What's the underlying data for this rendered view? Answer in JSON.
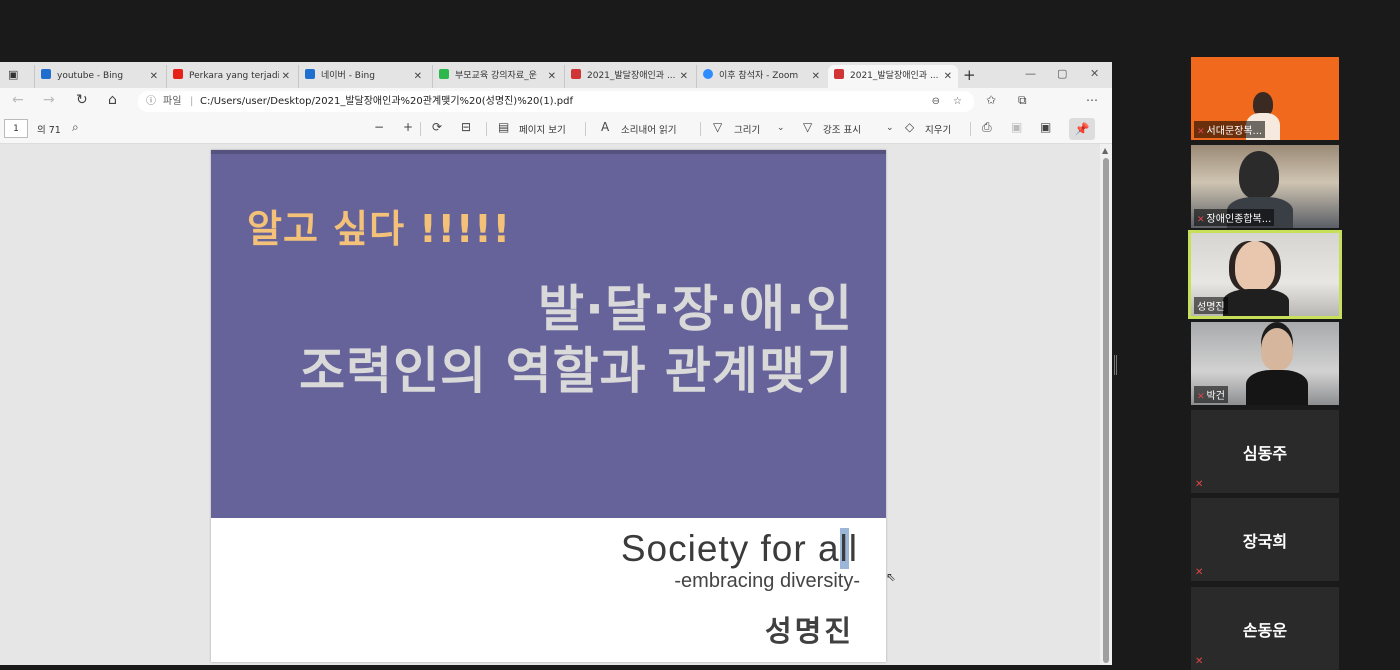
{
  "browser": {
    "tabs": [
      {
        "title": "youtube - Bing",
        "favicon": "bing-icon",
        "color": "#1f6fd1"
      },
      {
        "title": "Perkara yang terjadi a",
        "favicon": "youtube-icon",
        "color": "#e62117"
      },
      {
        "title": "네이버 - Bing",
        "favicon": "bing-icon",
        "color": "#1f6fd1"
      },
      {
        "title": "부모교육 강의자료_운",
        "favicon": "green-app-icon",
        "color": "#2db84d"
      },
      {
        "title": "2021_발달장애인과 ...",
        "favicon": "pdf-icon",
        "color": "#d03434"
      },
      {
        "title": "이후 참석자 - Zoom",
        "favicon": "zoom-icon",
        "color": "#2d8cff"
      },
      {
        "title": "2021_발달장애인과 ...",
        "favicon": "pdf-icon",
        "color": "#d03434"
      }
    ],
    "address": {
      "file_label": "파일",
      "url": "C:/Users/user/Desktop/2021_발달장애인과%20관계맺기%20(성명진)%20(1).pdf"
    }
  },
  "pdf_toolbar": {
    "page_number": "1",
    "page_total": "의 71",
    "page_view": "페이지 보기",
    "read_aloud": "소리내어 읽기",
    "draw": "그리기",
    "highlight": "강조 표시",
    "erase": "지우기"
  },
  "slide": {
    "tagline": "알고 싶다 !!!!!",
    "title_line1": "발·달·장·애·인",
    "title_line2": "조력인의 역할과  관계맺기",
    "society_prefix": "Society for a",
    "society_highlight": "l",
    "society_suffix": "l",
    "subtitle": "-embracing diversity-",
    "presenter": "성명진"
  },
  "participants": [
    {
      "name": "서대문장복...",
      "muted": true,
      "video": "orange"
    },
    {
      "name": "장애인종합복...",
      "muted": true,
      "video": "room"
    },
    {
      "name": "성명진",
      "muted": false,
      "video": "wall",
      "active": true
    },
    {
      "name": "박건",
      "muted": true,
      "video": "gray"
    },
    {
      "name": "심동주",
      "muted": true,
      "video": "none"
    },
    {
      "name": "장국희",
      "muted": true,
      "video": "none"
    },
    {
      "name": "손동운",
      "muted": true,
      "video": "none"
    }
  ]
}
